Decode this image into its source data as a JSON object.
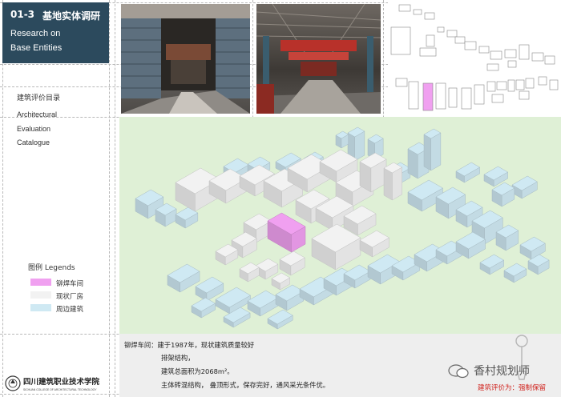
{
  "title": {
    "code": "01-3",
    "cn": "基地实体调研",
    "en_line1": "Research on",
    "en_line2": "Base Entities"
  },
  "sidebar": {
    "heading_cn": "建筑评价目录",
    "heading_en": [
      "Architectural",
      "Evaluation",
      "Catalogue"
    ]
  },
  "legend": {
    "title": "图例  Legends",
    "items": [
      {
        "label": "铆焊车间",
        "color": "#f0a0f0"
      },
      {
        "label": "现状厂房",
        "color": "#f2f2f2"
      },
      {
        "label": "周边建筑",
        "color": "#cfe9f3"
      }
    ]
  },
  "description": {
    "line1": "铆焊车间：建于1987年，现状建筑质量较好",
    "line2": "排架结构，",
    "line3": "建筑总面积为2068m²。",
    "line4": "主体砖混结构，  叠顶形式，保存完好，通风采光条件优。"
  },
  "school_logo_text": "四川建筑职业技术学院",
  "school_logo_subtext": "SICHUAN COLLEGE OF ARCHITECTURAL TECHNOLOGY",
  "wechat": {
    "name": "香村规划师"
  },
  "rating": "建筑评价为：强制保留",
  "colors": {
    "title_bg": "#2c4a5d",
    "highlight": "#f0a0f0",
    "existing": "#f2f2f2",
    "surrounding": "#cfe9f3",
    "ground": "#dff0d6",
    "rating": "#d0201b"
  }
}
